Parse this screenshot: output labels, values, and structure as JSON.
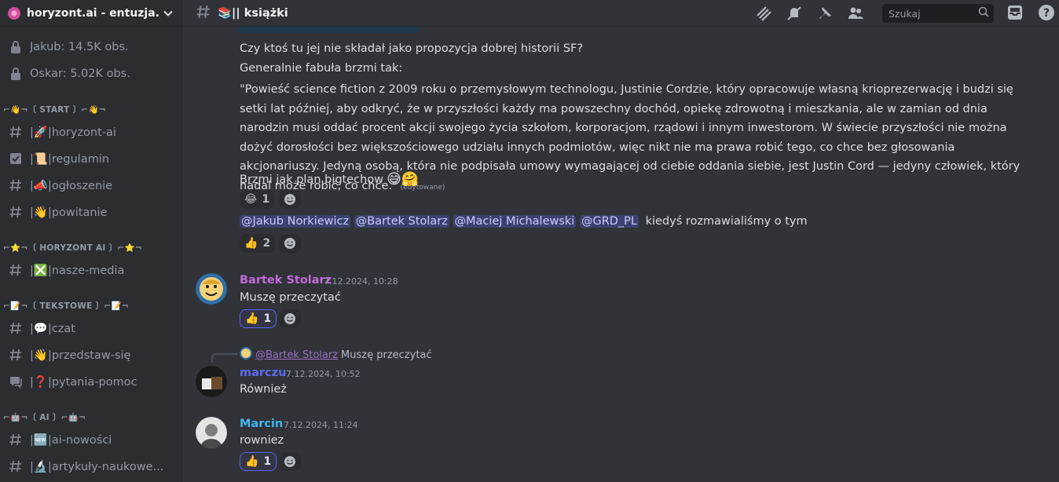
{
  "server": {
    "name": "horyzont.ai - entuzja...",
    "icon": "server-logo-icon"
  },
  "sidebar": {
    "locked_channels": [
      {
        "label": "Jakub: 14.5K obs.",
        "icon": "lock-icon"
      },
      {
        "label": "Oskar: 5.02K obs.",
        "icon": "lock-icon"
      }
    ],
    "categories": [
      {
        "label": "⌐👋¬〔 START 〕⌐👋¬",
        "channels": [
          {
            "label": "|🚀|horyzont-ai",
            "icon": "hash-icon"
          },
          {
            "label": "|📜|regulamin",
            "icon": "rules-icon"
          },
          {
            "label": "|📣|ogłoszenie",
            "icon": "hash-icon"
          },
          {
            "label": "|👋|powitanie",
            "icon": "hash-icon"
          }
        ]
      },
      {
        "label": "⌐⭐¬〔 HORYZONT AI 〕⌐⭐¬",
        "channels": [
          {
            "label": "|❎|nasze-media",
            "icon": "hash-icon"
          }
        ]
      },
      {
        "label": "⌐📝¬〔 TEKSTOWE 〕⌐📝¬",
        "channels": [
          {
            "label": "|💬|czat",
            "icon": "hash-icon"
          },
          {
            "label": "|👋|przedstaw-się",
            "icon": "hash-icon"
          },
          {
            "label": "|❓|pytania-pomoc",
            "icon": "forum-icon"
          }
        ]
      },
      {
        "label": "⌐🤖¬〔 AI 〕⌐🤖¬",
        "channels": [
          {
            "label": "|🆕|ai-nowości",
            "icon": "hash-icon"
          },
          {
            "label": "|🔬|artykuły-naukowe...",
            "icon": "hash-icon"
          }
        ]
      }
    ]
  },
  "topbar": {
    "channel": "📚|| książki",
    "search_placeholder": "Szukaj",
    "icons": [
      "threads-icon",
      "mute-icon",
      "pin-icon",
      "members-icon",
      "search-icon",
      "inbox-icon",
      "help-icon"
    ]
  },
  "messages": {
    "m1": {
      "line1": "Czy ktoś tu jej nie składał jako propozycja dobrej historii SF?",
      "line2": "Generalnie fabuła brzmi tak:",
      "quote": "\"Powieść science fiction z 2009 roku o przemysłowym technologu, Justinie Cordzie, który opracowuje własną krioprezerwację i budzi się setki lat później, aby odkryć, że w przyszłości każdy ma powszechny dochód, opiekę zdrowotną i mieszkania, ale w zamian od dnia narodzin musi oddać procent akcji swojego życia szkołom, korporacjom, rządowi i innym inwestorom. W świecie przyszłości nie można dożyć dorosłości bez większościowego udziału innych podmiotów, więc nikt nie ma prawa robić tego, co chce bez głosowania akcjonariuszy. Jedyną osobą, która nie podpisała umowy wymagającej od ciebie oddania siebie, jest Justin Cord — jedyny człowiek, który nadal może robić, co chce.\"",
      "edited": "(edytowane)",
      "line3": "Brzmi jak plan bigtechow",
      "line3_emoji": "😅🤗",
      "reaction1": {
        "emoji": "😂",
        "count": "1"
      }
    },
    "m2": {
      "mentions": [
        "@Jakub Norkiewicz",
        "@Bartek Stolarz",
        "@Maciej Michalewski",
        "@GRD_PL"
      ],
      "text": "kiedyś rozmawialiśmy o tym",
      "reaction1": {
        "emoji": "👍",
        "count": "2"
      }
    },
    "m3": {
      "author": "Bartek Stolarz",
      "author_color": "#c06bd6",
      "time": "7.12.2024, 10:28",
      "text": "Muszę przeczytać",
      "reaction1": {
        "emoji": "👍",
        "count": "1"
      }
    },
    "m4": {
      "reply_author": "@Bartek Stolarz",
      "reply_text": "Muszę przeczytać",
      "author": "marczu",
      "author_color": "#5a6cf0",
      "time": "7.12.2024, 10:52",
      "text": "Również"
    },
    "m5": {
      "author": "Marcin",
      "author_color": "#3fb6f2",
      "time": "7.12.2024, 11:24",
      "text": "rowniez",
      "reaction1": {
        "emoji": "👍",
        "count": "1"
      }
    },
    "add_reaction_icon": "add-reaction-icon"
  }
}
